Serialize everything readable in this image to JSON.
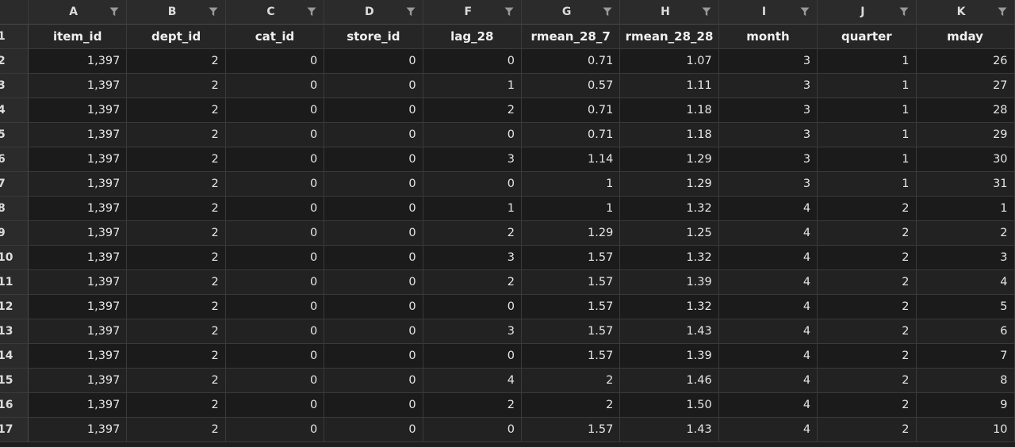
{
  "colors": {
    "background": "#1e1e1e",
    "header_bg": "#2b2b2b",
    "gridline": "#3a3a3a",
    "text": "#e6e6e6"
  },
  "column_letters": [
    "A",
    "B",
    "C",
    "D",
    "F",
    "G",
    "H",
    "I",
    "J",
    "K"
  ],
  "filter_icon": "filter-funnel-icon",
  "headers": [
    "item_id",
    "dept_id",
    "cat_id",
    "store_id",
    "lag_28",
    "rmean_28_7",
    "rmean_28_28",
    "month",
    "quarter",
    "mday"
  ],
  "rows": [
    {
      "num": "2",
      "cells": [
        "1,397",
        "2",
        "0",
        "0",
        "0",
        "0.71",
        "1.07",
        "3",
        "1",
        "26"
      ]
    },
    {
      "num": "3",
      "cells": [
        "1,397",
        "2",
        "0",
        "0",
        "1",
        "0.57",
        "1.11",
        "3",
        "1",
        "27"
      ]
    },
    {
      "num": "4",
      "cells": [
        "1,397",
        "2",
        "0",
        "0",
        "2",
        "0.71",
        "1.18",
        "3",
        "1",
        "28"
      ]
    },
    {
      "num": "5",
      "cells": [
        "1,397",
        "2",
        "0",
        "0",
        "0",
        "0.71",
        "1.18",
        "3",
        "1",
        "29"
      ]
    },
    {
      "num": "6",
      "cells": [
        "1,397",
        "2",
        "0",
        "0",
        "3",
        "1.14",
        "1.29",
        "3",
        "1",
        "30"
      ]
    },
    {
      "num": "7",
      "cells": [
        "1,397",
        "2",
        "0",
        "0",
        "0",
        "1",
        "1.29",
        "3",
        "1",
        "31"
      ]
    },
    {
      "num": "8",
      "cells": [
        "1,397",
        "2",
        "0",
        "0",
        "1",
        "1",
        "1.32",
        "4",
        "2",
        "1"
      ]
    },
    {
      "num": "9",
      "cells": [
        "1,397",
        "2",
        "0",
        "0",
        "2",
        "1.29",
        "1.25",
        "4",
        "2",
        "2"
      ]
    },
    {
      "num": "10",
      "cells": [
        "1,397",
        "2",
        "0",
        "0",
        "3",
        "1.57",
        "1.32",
        "4",
        "2",
        "3"
      ]
    },
    {
      "num": "11",
      "cells": [
        "1,397",
        "2",
        "0",
        "0",
        "2",
        "1.57",
        "1.39",
        "4",
        "2",
        "4"
      ]
    },
    {
      "num": "12",
      "cells": [
        "1,397",
        "2",
        "0",
        "0",
        "0",
        "1.57",
        "1.32",
        "4",
        "2",
        "5"
      ]
    },
    {
      "num": "13",
      "cells": [
        "1,397",
        "2",
        "0",
        "0",
        "3",
        "1.57",
        "1.43",
        "4",
        "2",
        "6"
      ]
    },
    {
      "num": "14",
      "cells": [
        "1,397",
        "2",
        "0",
        "0",
        "0",
        "1.57",
        "1.39",
        "4",
        "2",
        "7"
      ]
    },
    {
      "num": "15",
      "cells": [
        "1,397",
        "2",
        "0",
        "0",
        "4",
        "2",
        "1.46",
        "4",
        "2",
        "8"
      ]
    },
    {
      "num": "16",
      "cells": [
        "1,397",
        "2",
        "0",
        "0",
        "2",
        "2",
        "1.50",
        "4",
        "2",
        "9"
      ]
    },
    {
      "num": "17",
      "cells": [
        "1,397",
        "2",
        "0",
        "0",
        "0",
        "1.57",
        "1.43",
        "4",
        "2",
        "10"
      ]
    }
  ],
  "header_row_num": "1"
}
